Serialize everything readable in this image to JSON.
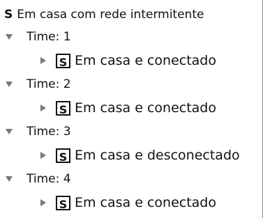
{
  "root": {
    "badge": "S",
    "label": "Em casa com rede intermitente"
  },
  "groups": [
    {
      "label": "Time: 1",
      "child": {
        "badge": "S",
        "label": "Em casa e conectado"
      }
    },
    {
      "label": "Time: 2",
      "child": {
        "badge": "S",
        "label": "Em casa e conectado"
      }
    },
    {
      "label": "Time: 3",
      "child": {
        "badge": "S",
        "label": "Em casa e desconectado"
      }
    },
    {
      "label": "Time: 4",
      "child": {
        "badge": "S",
        "label": "Em casa e conectado"
      }
    }
  ]
}
